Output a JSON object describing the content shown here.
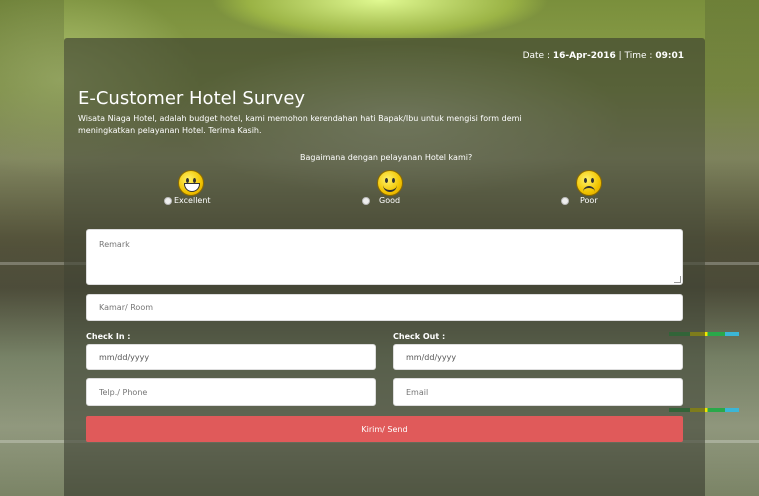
{
  "header": {
    "date_label": "Date :",
    "date_value": "16-Apr-2016",
    "separator": "|",
    "time_label": "Time :",
    "time_value": "09:01"
  },
  "title": "E-Customer Hotel Survey",
  "subtitle": "Wisata Niaga Hotel, adalah budget hotel, kami memohon kerendahan hati Bapak/Ibu untuk mengisi form demi meningkatkan pelayanan Hotel. Terima Kasih.",
  "question": "Bagaimana dengan pelayanan Hotel kami?",
  "ratings": [
    {
      "label": "Excellent",
      "icon": "grinning-face-icon"
    },
    {
      "label": "Good",
      "icon": "smiling-face-icon"
    },
    {
      "label": "Poor",
      "icon": "sad-face-icon"
    }
  ],
  "form": {
    "remark_placeholder": "Remark",
    "room_placeholder": "Kamar/ Room",
    "checkin_label": "Check In :",
    "checkin_value": "mm/dd/yyyy",
    "checkout_label": "Check Out :",
    "checkout_value": "mm/dd/yyyy",
    "phone_placeholder": "Telp./ Phone",
    "email_placeholder": "Email",
    "send_label": "Kirim/ Send"
  }
}
